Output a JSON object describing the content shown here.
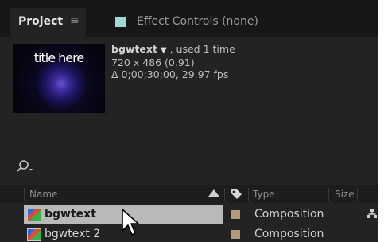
{
  "tabs": {
    "project_label": "Project",
    "project_menu_icon": "hamburger-menu-icon",
    "effect_controls_label": "Effect Controls (none)",
    "effect_controls_color": "#a3d7d5"
  },
  "preview": {
    "thumbnail_text": "title here",
    "name": "bgwtext",
    "dropdown_icon": "triangle-down-icon",
    "usage": ", used 1 time",
    "dimensions": "720 x 486 (0.91)",
    "duration": "Δ 0;00;30;00, 29.97 fps"
  },
  "search": {
    "icon": "search-icon"
  },
  "table": {
    "columns": {
      "name": "Name",
      "label_icon": "tag-icon",
      "type": "Type",
      "size": "Size"
    },
    "rows": [
      {
        "name": "bgwtext",
        "type": "Composition",
        "selected": true
      },
      {
        "name": "bgwtext 2",
        "type": "Composition",
        "selected": false
      }
    ]
  },
  "colors": {
    "panel_bg": "#232323",
    "selection": "#b9b9b9",
    "label_swatch": "#b39a7a"
  }
}
